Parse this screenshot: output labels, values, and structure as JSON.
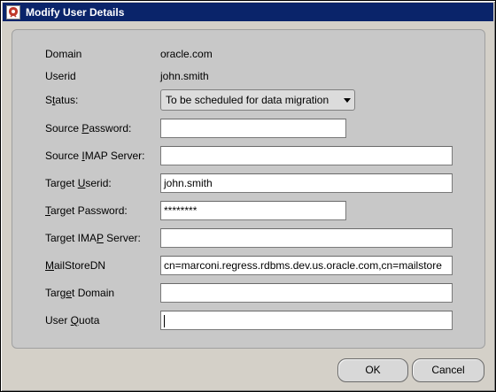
{
  "window": {
    "title": "Modify User Details",
    "icon": "app-icon"
  },
  "form": {
    "domain": {
      "label": "Domain",
      "value": "oracle.com"
    },
    "userid": {
      "label": "Userid",
      "value": "john.smith"
    },
    "status": {
      "label_pre": "S",
      "label_mn": "t",
      "label_post": "atus:",
      "value": "To be scheduled for data migration"
    },
    "source_password": {
      "label_pre": "Source ",
      "label_mn": "P",
      "label_post": "assword:",
      "value": ""
    },
    "source_imap": {
      "label_pre": "Source ",
      "label_mn": "I",
      "label_post": "MAP Server:",
      "value": ""
    },
    "target_userid": {
      "label_pre": "Target ",
      "label_mn": "U",
      "label_post": "serid:",
      "value": "john.smith"
    },
    "target_password": {
      "label_pre": "",
      "label_mn": "T",
      "label_post": "arget Password:",
      "value": "********"
    },
    "target_imap": {
      "label_pre": "Target IMA",
      "label_mn": "P",
      "label_post": " Server:",
      "value": ""
    },
    "mailstoredn": {
      "label_pre": "",
      "label_mn": "M",
      "label_post": "ailStoreDN",
      "value": "cn=marconi.regress.rdbms.dev.us.oracle.com,cn=mailstore"
    },
    "target_domain": {
      "label_pre": "Targ",
      "label_mn": "e",
      "label_post": "t Domain",
      "value": ""
    },
    "user_quota": {
      "label_pre": "User ",
      "label_mn": "Q",
      "label_post": "uota",
      "value": ""
    }
  },
  "buttons": {
    "ok": "OK",
    "cancel": "Cancel"
  }
}
